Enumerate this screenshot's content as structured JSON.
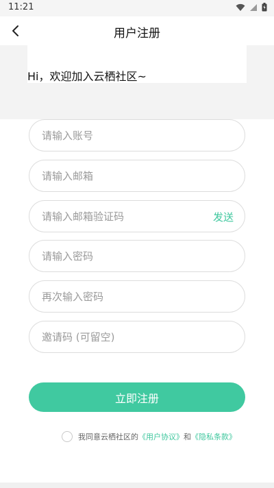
{
  "status_bar": {
    "time": "11:21",
    "icons": [
      "wifi-icon",
      "signal-icon",
      "battery-icon"
    ]
  },
  "header": {
    "title": "用户注册",
    "back_icon": "chevron-left-icon"
  },
  "banner": {
    "greeting": "Hi，欢迎加入云栖社区~"
  },
  "form": {
    "account_placeholder": "请输入账号",
    "email_placeholder": "请输入邮箱",
    "code_placeholder": "请输入邮箱验证码",
    "send_label": "发送",
    "password_placeholder": "请输入密码",
    "confirm_placeholder": "再次输入密码",
    "invite_placeholder": "邀请码 (可留空)"
  },
  "submit": {
    "label": "立即注册"
  },
  "agreement": {
    "prefix": "我同意云栖社区的",
    "user_agreement": "《用户协议》",
    "conjunction": "和",
    "privacy_policy": "《隐私条款》"
  },
  "colors": {
    "accent": "#40c9a0",
    "link": "#3fc79e",
    "banner_bg": "#f3f3f3"
  }
}
